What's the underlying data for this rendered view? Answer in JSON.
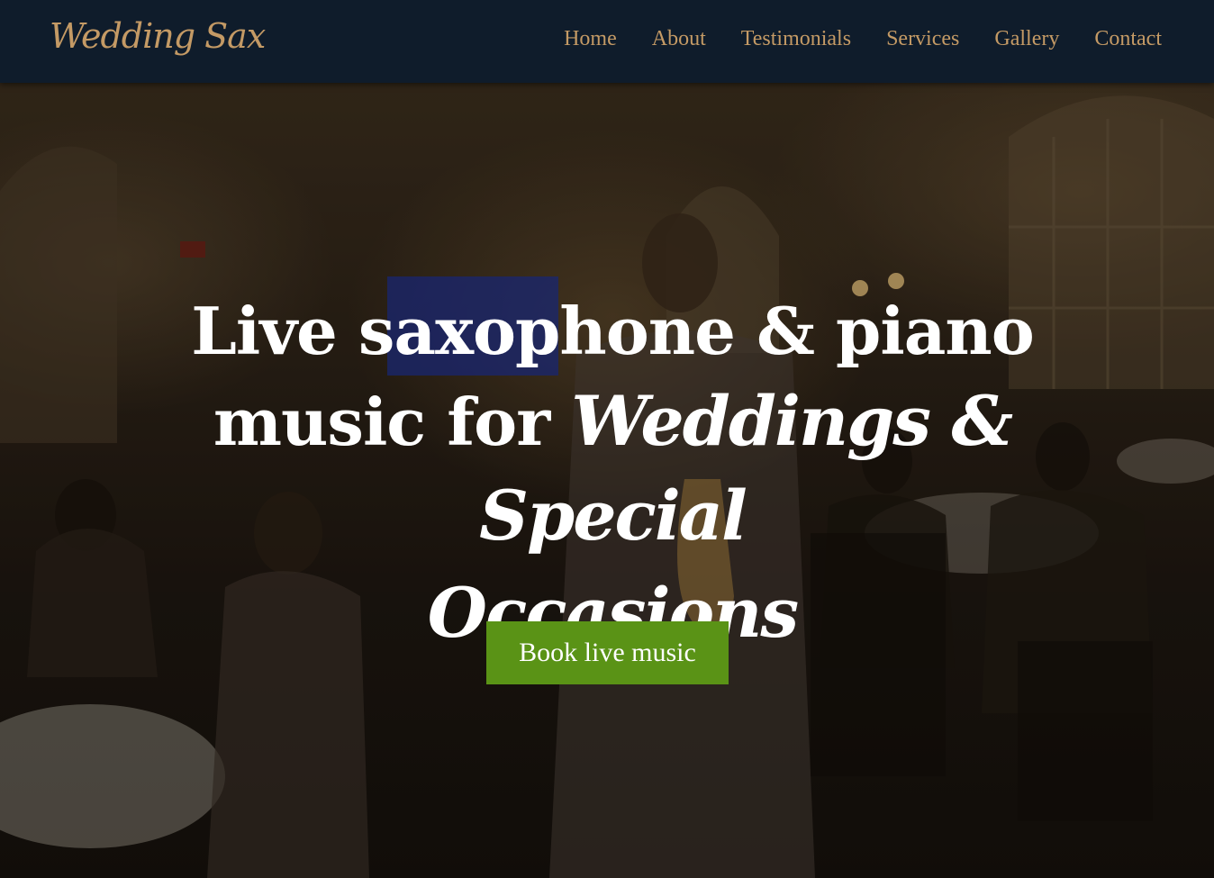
{
  "nav": {
    "logo": "Wedding Sax",
    "links": [
      "Home",
      "About",
      "Testimonials",
      "Services",
      "Gallery",
      "Contact"
    ]
  },
  "hero": {
    "line1": "Live saxophone & piano",
    "line2_plain": "music for ",
    "line2_script": "Weddings & Special",
    "line3_script": "Occasions",
    "cta_label": "Book live music"
  },
  "colors": {
    "nav_bg": "#0f1c2b",
    "nav_text": "#c49a65",
    "cta_bg": "#5a9316",
    "hero_text": "#ffffff"
  }
}
